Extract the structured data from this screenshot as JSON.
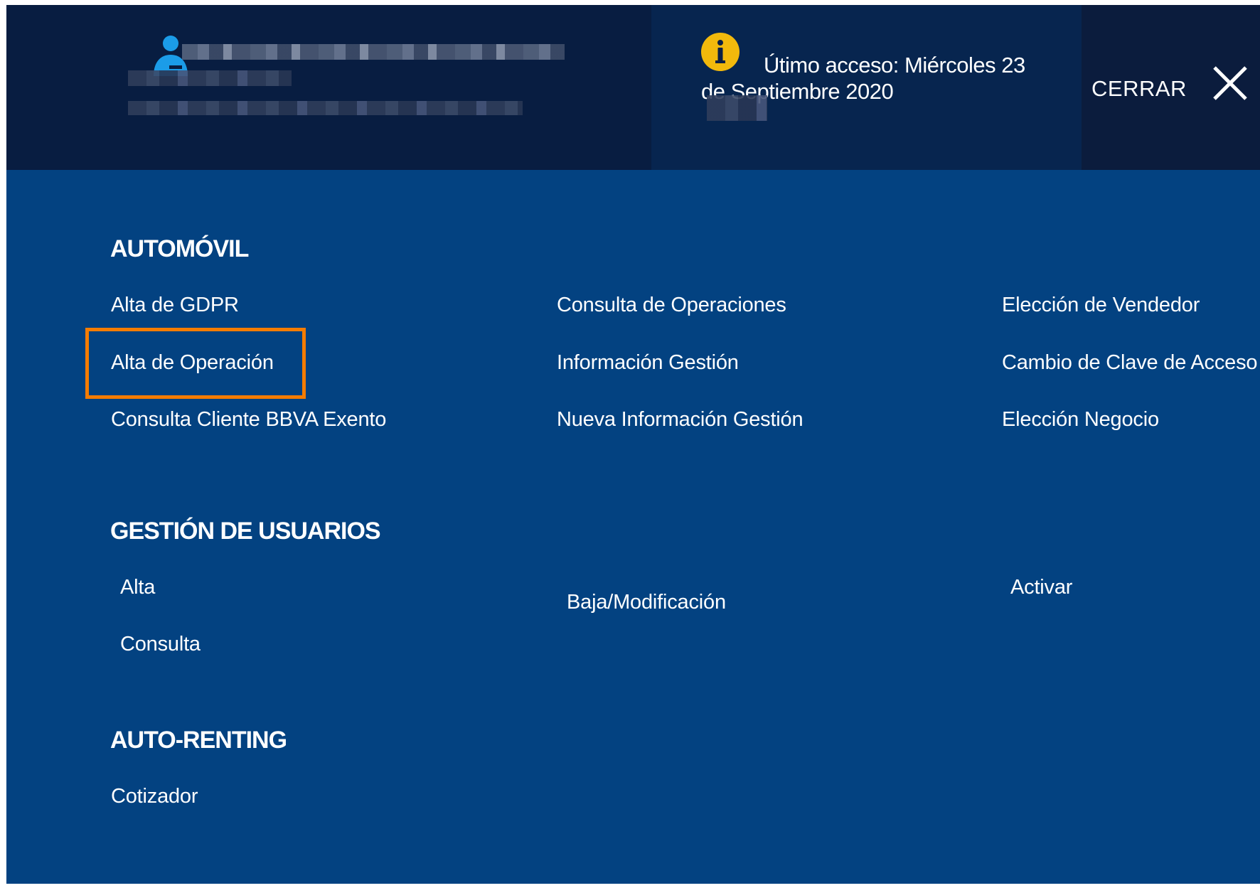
{
  "header": {
    "last_access_line1": "Útimo acceso: Miércoles 23",
    "last_access_line2": "de Septiembre 2020",
    "close_label": "CERRAR"
  },
  "icons": {
    "user": "user-icon",
    "info": "info-icon",
    "close": "close-icon"
  },
  "colors": {
    "header_bg": "#081d41",
    "menu_bg": "#034281",
    "info_icon": "#f2b90c",
    "user_icon": "#1b9ce8",
    "highlight": "#f57c00"
  },
  "sections": {
    "automovil": {
      "title": "AUTOMÓVIL",
      "col1": [
        "Alta de GDPR",
        "Alta de Operación",
        "Consulta Cliente BBVA Exento"
      ],
      "col2": [
        "Consulta de Operaciones",
        "Información Gestión",
        "Nueva Información Gestión"
      ],
      "col3": [
        "Elección de Vendedor",
        "Cambio de Clave de Acceso",
        "Elección Negocio"
      ]
    },
    "gestion_usuarios": {
      "title": "GESTIÓN DE USUARIOS",
      "col1": [
        "Alta",
        "Consulta"
      ],
      "col2": [
        "Baja/Modificación"
      ],
      "col3": [
        "Activar"
      ]
    },
    "auto_renting": {
      "title": "AUTO-RENTING",
      "col1": [
        "Cotizador"
      ]
    }
  }
}
